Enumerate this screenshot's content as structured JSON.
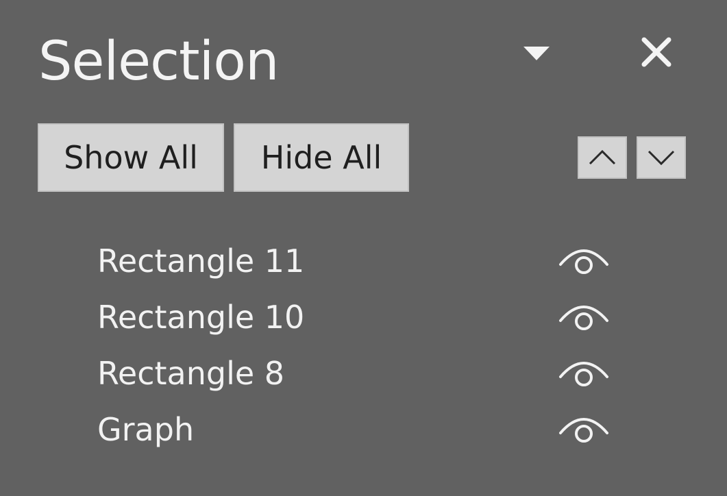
{
  "pane": {
    "title": "Selection",
    "options_icon": "dropdown-triangle-icon",
    "close_icon": "close-icon"
  },
  "toolbar": {
    "show_all_label": "Show All",
    "hide_all_label": "Hide All",
    "bring_forward_icon": "chevron-up-icon",
    "send_backward_icon": "chevron-down-icon"
  },
  "items": [
    {
      "label": "Rectangle 11",
      "visible": true,
      "icon": "eye-icon"
    },
    {
      "label": "Rectangle 10",
      "visible": true,
      "icon": "eye-icon"
    },
    {
      "label": "Rectangle 8",
      "visible": true,
      "icon": "eye-icon"
    },
    {
      "label": "Graph",
      "visible": true,
      "icon": "eye-icon"
    }
  ],
  "colors": {
    "background": "#616161",
    "button": "#d4d4d4",
    "text": "#f2f2f2"
  }
}
